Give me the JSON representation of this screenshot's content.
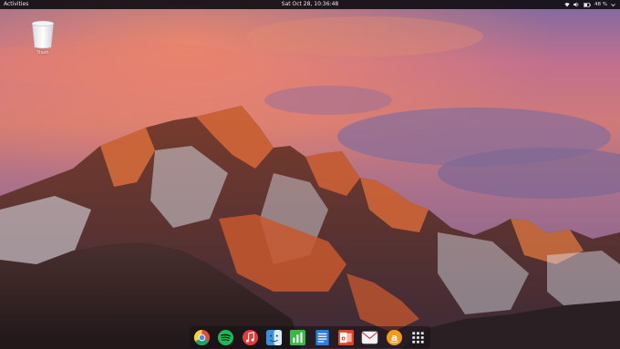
{
  "topbar": {
    "activities_label": "Activities",
    "clock": "Sat Oct 28, 10:36:48",
    "battery_percent": "48 %",
    "tray_icons": [
      "network-icon",
      "volume-icon",
      "battery-icon",
      "power-menu-icon"
    ]
  },
  "desktop": {
    "trash_label": "Trash"
  },
  "dock": {
    "apps": [
      "chrome",
      "spotify",
      "music",
      "finder",
      "numbers",
      "docs",
      "office",
      "mail",
      "amazon",
      "app-grid"
    ],
    "app_colors": {
      "chrome": "#dd4b39",
      "spotify": "#1db954",
      "music": "#e33b3b",
      "finder": "#3d8fd8",
      "numbers": "#3cb54a",
      "docs": "#2f7be0",
      "office": "#d9442a",
      "mail": "#f2f2f2",
      "amazon": "#f39a1e"
    }
  }
}
